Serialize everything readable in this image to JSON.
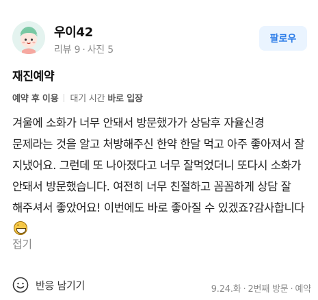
{
  "user": {
    "name": "우이42",
    "reviews_label": "리뷰 9",
    "photos_label": "사진 5",
    "follow_label": "팔로우",
    "avatar_icon": "avatar-character-icon"
  },
  "review": {
    "title": "재진예약",
    "meta": {
      "reservation_label": "예약 후 이용",
      "wait_label": "대기 시간",
      "wait_value": "바로 입장"
    },
    "body": "겨울에 소화가 너무 안돼서 방문했가가 상담후 자율신경 문제라는 것을 알고 처방해주신 한약 한달 먹고 아주 좋아져서 잘 지냈어요. 그런데 또 나아졌다고 너무 잘먹었더니 또다시 소화가 안돼서 방문했습니다. 여전히 너무 친절하고 꼼꼼하게 상담 잘 해주셔서 좋았어요! 이번에도 바로 좋아질 수 있겠죠?감사합니다",
    "emoji_icon": "grinning-face-icon",
    "fold_label": "접기"
  },
  "footer": {
    "react_label": "반응 남기기",
    "react_icon": "smiley-outline-icon",
    "date": "9.24.화",
    "visit": "2번째 방문",
    "type": "예약"
  },
  "colors": {
    "accent": "#2f7ee8",
    "follow_bg": "#eaf4ff",
    "muted_text": "#8a8a8a"
  }
}
